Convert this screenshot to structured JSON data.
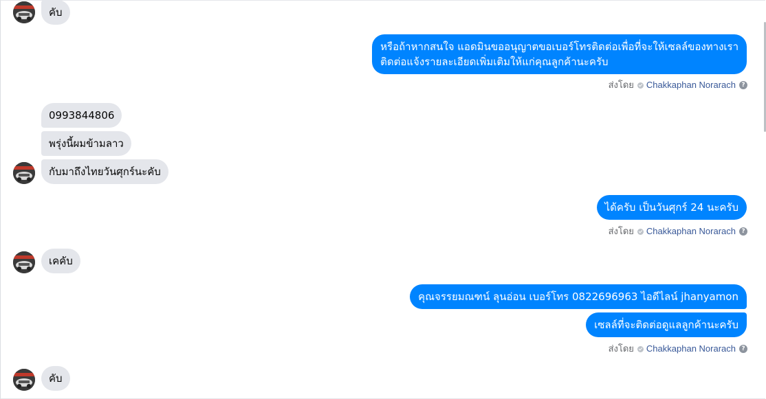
{
  "messages": {
    "m1": "คับ",
    "m2_line1": "หรือถ้าหากสนใจ แอดมินขออนุญาตขอเบอร์โทรติดต่อเพื่อที่จะให้เซลล์ของทางเรา",
    "m2_line2": "ติดต่อแจ้งรายละเอียดเพิ่มเติมให้แก่คุณลูกค้านะครับ",
    "m3": "0993844806",
    "m4": "พรุ่งนี้ผมข้ามลาว",
    "m5": "กับมาถึงไทยวันศุกร์นะคับ",
    "m6": "ได้ครับ เป็นวันศุกร์ 24 นะครับ",
    "m7": "เคคับ",
    "m8": "คุณจรรยมณฑน์ ลุนอ่อน เบอร์โทร 0822696963  ไอดีไลน์  jhanyamon",
    "m9": "เซลล์ที่จะติดต่อดูแลลูกค้านะครับ",
    "m10": "คับ"
  },
  "sent_by": {
    "label": "ส่งโดย",
    "name": "Chakkaphan Norarach",
    "help": "?"
  },
  "icons": {
    "verified": "check-circle-icon",
    "help": "question-circle-icon",
    "avatar": "car-avatar"
  },
  "colors": {
    "outgoing_bubble": "#0084ff",
    "incoming_bubble": "#e4e6eb",
    "sender_name": "#385898"
  }
}
